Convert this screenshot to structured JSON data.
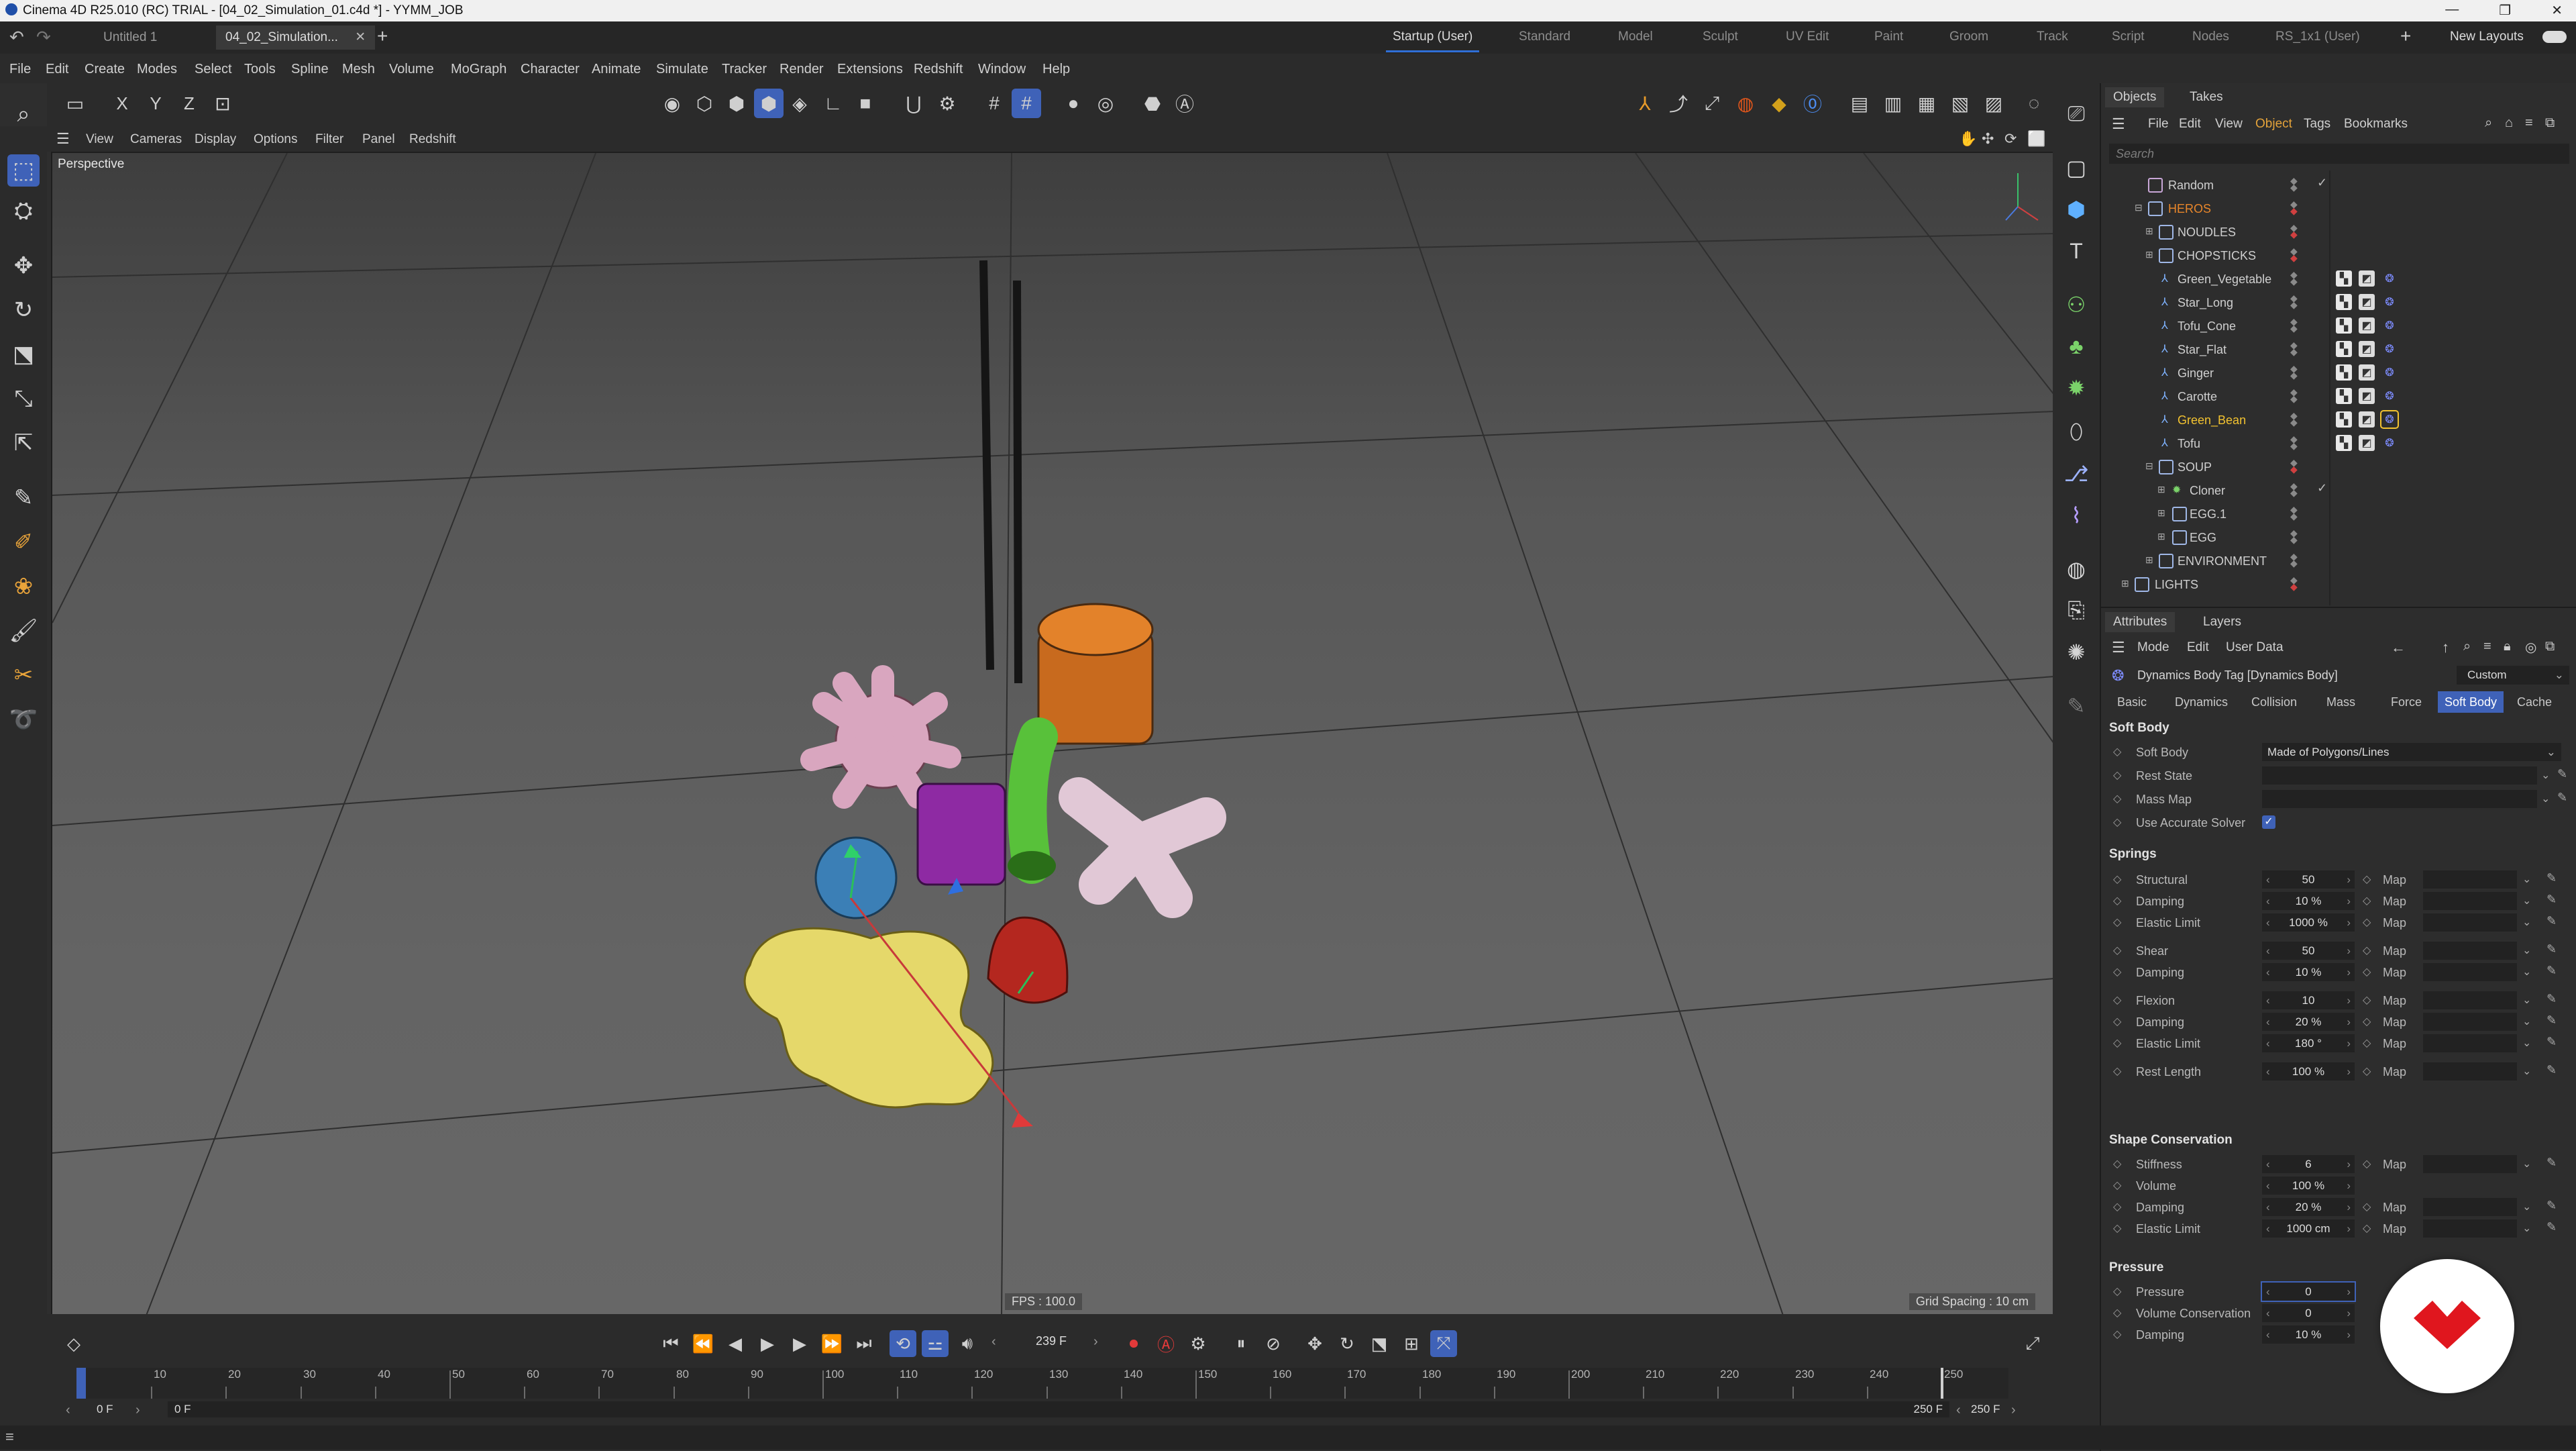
{
  "window": {
    "title": "Cinema 4D R25.010 (RC) TRIAL - [04_02_Simulation_01.c4d *] - YYMM_JOB"
  },
  "doc_tabs": [
    "Untitled 1",
    "04_02_Simulation..."
  ],
  "layouts": {
    "items": [
      "Startup (User)",
      "Standard",
      "Model",
      "Sculpt",
      "UV Edit",
      "Paint",
      "Groom",
      "Track",
      "Script",
      "Nodes",
      "RS_1x1 (User)"
    ],
    "active": "Startup (User)",
    "new_layouts": "New Layouts"
  },
  "menu": [
    "File",
    "Edit",
    "Create",
    "Modes",
    "Select",
    "Tools",
    "Spline",
    "Mesh",
    "Volume",
    "MoGraph",
    "Character",
    "Animate",
    "Simulate",
    "Tracker",
    "Render",
    "Extensions",
    "Redshift",
    "Window",
    "Help"
  ],
  "axis_toggles": [
    "X",
    "Y",
    "Z"
  ],
  "viewport": {
    "menu": [
      "View",
      "Cameras",
      "Display",
      "Options",
      "Filter",
      "Panel",
      "Redshift"
    ],
    "camera_label": "Perspective",
    "fps": "FPS : 100.0",
    "grid_spacing": "Grid Spacing : 10 cm"
  },
  "objects_panel": {
    "tabs": [
      "Objects",
      "Takes"
    ],
    "menu": [
      "File",
      "Edit",
      "View",
      "Object",
      "Tags",
      "Bookmarks"
    ],
    "search_placeholder": "Search",
    "rows": [
      {
        "name": "Random",
        "highlight": false
      },
      {
        "name": "HEROS",
        "highlight": true,
        "color": "#e8862a"
      },
      {
        "name": "NOUDLES",
        "highlight": false
      },
      {
        "name": "CHOPSTICKS",
        "highlight": false
      },
      {
        "name": "Green_Vegetable",
        "highlight": false
      },
      {
        "name": "Star_Long",
        "highlight": false
      },
      {
        "name": "Tofu_Cone",
        "highlight": false
      },
      {
        "name": "Star_Flat",
        "highlight": false
      },
      {
        "name": "Ginger",
        "highlight": false
      },
      {
        "name": "Carotte",
        "highlight": false
      },
      {
        "name": "Green_Bean",
        "highlight": true,
        "color": "#f2c230"
      },
      {
        "name": "Tofu",
        "highlight": false
      },
      {
        "name": "SOUP",
        "highlight": false
      },
      {
        "name": "Cloner",
        "highlight": false
      },
      {
        "name": "EGG.1",
        "highlight": false
      },
      {
        "name": "EGG",
        "highlight": false
      },
      {
        "name": "ENVIRONMENT",
        "highlight": false
      },
      {
        "name": "LIGHTS",
        "highlight": false
      }
    ]
  },
  "attributes": {
    "tabs": [
      "Attributes",
      "Layers"
    ],
    "menu": [
      "Mode",
      "Edit",
      "User Data"
    ],
    "tag_title": "Dynamics Body Tag [Dynamics Body]",
    "preset": "Custom",
    "subtabs": [
      "Basic",
      "Dynamics",
      "Collision",
      "Mass",
      "Force",
      "Soft Body",
      "Cache"
    ],
    "active_subtab": "Soft Body",
    "soft_body_section": "Soft Body",
    "soft_body_label": "Soft Body",
    "soft_body_value": "Made of Polygons/Lines",
    "rest_state": "Rest State",
    "mass_map": "Mass Map",
    "accurate_solver": "Use Accurate Solver",
    "springs_section": "Springs",
    "springs": [
      {
        "label": "Structural",
        "value": "50",
        "map": true
      },
      {
        "label": "Damping",
        "value": "10 %",
        "map": true
      },
      {
        "label": "Elastic Limit",
        "value": "1000 %",
        "map": true
      },
      {
        "label": "Shear",
        "value": "50",
        "map": true
      },
      {
        "label": "Damping",
        "value": "10 %",
        "map": true
      },
      {
        "label": "Flexion",
        "value": "10",
        "map": true
      },
      {
        "label": "Damping",
        "value": "20 %",
        "map": true
      },
      {
        "label": "Elastic Limit",
        "value": "180 °",
        "map": true
      },
      {
        "label": "Rest Length",
        "value": "100 %",
        "map": true
      }
    ],
    "shape_section": "Shape Conservation",
    "shape": [
      {
        "label": "Stiffness",
        "value": "6",
        "map": true
      },
      {
        "label": "Volume",
        "value": "100 %",
        "map": false
      },
      {
        "label": "Damping",
        "value": "20 %",
        "map": true
      },
      {
        "label": "Elastic Limit",
        "value": "1000 cm",
        "map": true
      }
    ],
    "pressure_section": "Pressure",
    "pressure": [
      {
        "label": "Pressure",
        "value": "0",
        "map": false
      },
      {
        "label": "Volume Conservation",
        "value": "0",
        "map": false
      },
      {
        "label": "Damping",
        "value": "10 %",
        "map": false
      }
    ],
    "map_label": "Map"
  },
  "timeline": {
    "current_frame": "239 F",
    "ticks": [
      "0",
      "10",
      "20",
      "30",
      "40",
      "50",
      "60",
      "70",
      "80",
      "90",
      "100",
      "110",
      "120",
      "130",
      "140",
      "150",
      "160",
      "170",
      "180",
      "190",
      "200",
      "210",
      "220",
      "230",
      "240",
      "250"
    ],
    "start_left": "0 F",
    "start_right": "0 F",
    "end_left": "250 F",
    "end_right": "250 F"
  }
}
